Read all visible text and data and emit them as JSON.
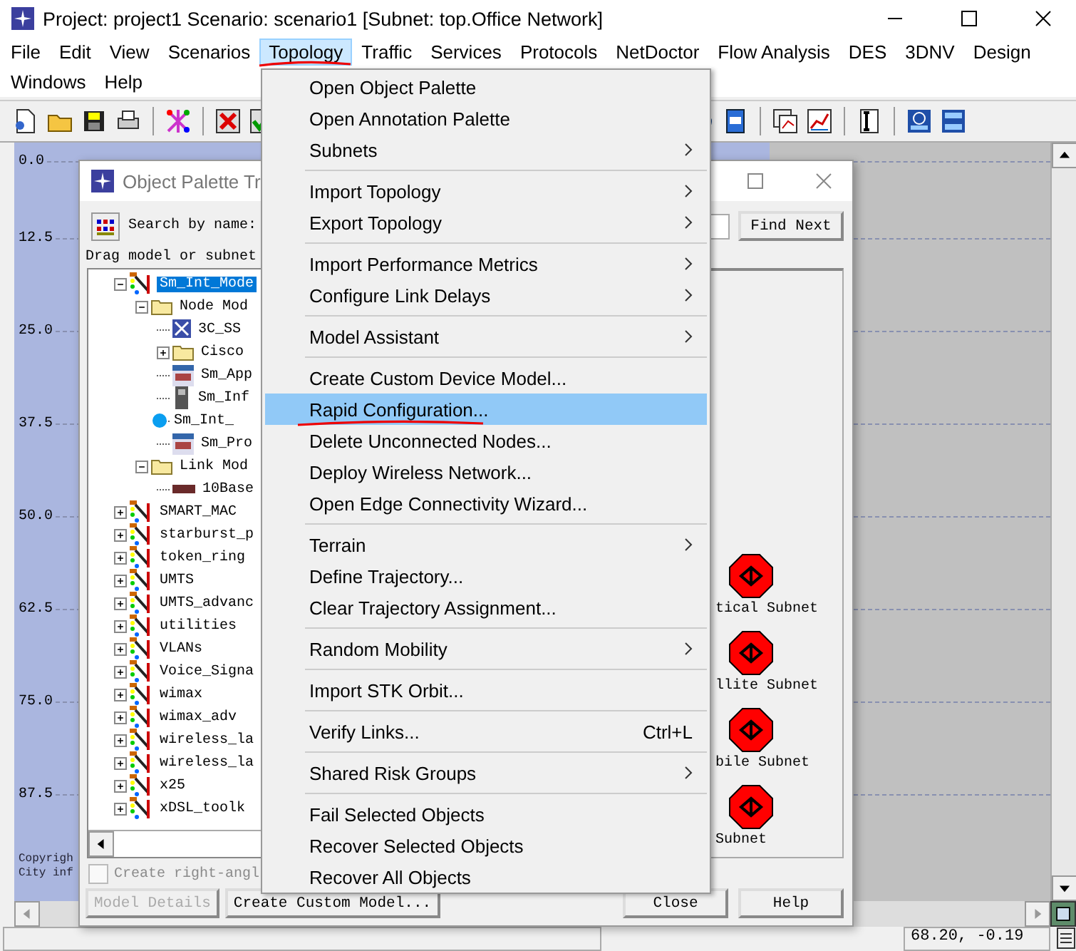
{
  "window": {
    "title": "Project: project1 Scenario: scenario1  [Subnet: top.Office Network]"
  },
  "menu_bar": [
    [
      {
        "label": "File",
        "selected": false,
        "annotated": false
      },
      {
        "label": "Edit",
        "selected": false,
        "annotated": false
      },
      {
        "label": "View",
        "selected": false,
        "annotated": false
      },
      {
        "label": "Scenarios",
        "selected": false,
        "annotated": false
      },
      {
        "label": "Topology",
        "selected": true,
        "annotated": true
      },
      {
        "label": "Traffic",
        "selected": false,
        "annotated": false
      },
      {
        "label": "Services",
        "selected": false,
        "annotated": false
      },
      {
        "label": "Protocols",
        "selected": false,
        "annotated": false
      },
      {
        "label": "NetDoctor",
        "selected": false,
        "annotated": false
      },
      {
        "label": "Flow Analysis",
        "selected": false,
        "annotated": false
      },
      {
        "label": "DES",
        "selected": false,
        "annotated": false
      },
      {
        "label": "3DNV",
        "selected": false,
        "annotated": false
      },
      {
        "label": "Design",
        "selected": false,
        "annotated": false
      }
    ],
    [
      {
        "label": "Windows",
        "selected": false,
        "annotated": false
      },
      {
        "label": "Help",
        "selected": false,
        "annotated": false
      }
    ]
  ],
  "topology_menu": [
    [
      {
        "label": "Open Object Palette",
        "submenu": false,
        "selected": false,
        "annotated": false
      },
      {
        "label": "Open Annotation Palette",
        "submenu": false,
        "selected": false,
        "annotated": false
      },
      {
        "label": "Subnets",
        "submenu": true,
        "selected": false,
        "annotated": false
      }
    ],
    [
      {
        "label": "Import Topology",
        "submenu": true,
        "selected": false,
        "annotated": false
      },
      {
        "label": "Export Topology",
        "submenu": true,
        "selected": false,
        "annotated": false
      }
    ],
    [
      {
        "label": "Import Performance Metrics",
        "submenu": true,
        "selected": false,
        "annotated": false
      },
      {
        "label": "Configure Link Delays",
        "submenu": true,
        "selected": false,
        "annotated": false
      }
    ],
    [
      {
        "label": "Model Assistant",
        "submenu": true,
        "selected": false,
        "annotated": false
      }
    ],
    [
      {
        "label": "Create Custom Device Model...",
        "submenu": false,
        "selected": false,
        "annotated": false
      },
      {
        "label": "Rapid Configuration...",
        "submenu": false,
        "selected": true,
        "annotated": true
      },
      {
        "label": "Delete Unconnected Nodes...",
        "submenu": false,
        "selected": false,
        "annotated": false
      },
      {
        "label": "Deploy Wireless Network...",
        "submenu": false,
        "selected": false,
        "annotated": false
      },
      {
        "label": "Open Edge Connectivity Wizard...",
        "submenu": false,
        "selected": false,
        "annotated": false
      }
    ],
    [
      {
        "label": "Terrain",
        "submenu": true,
        "selected": false,
        "annotated": false
      },
      {
        "label": "Define Trajectory...",
        "submenu": false,
        "selected": false,
        "annotated": false
      },
      {
        "label": "Clear Trajectory Assignment...",
        "submenu": false,
        "selected": false,
        "annotated": false
      }
    ],
    [
      {
        "label": "Random Mobility",
        "submenu": true,
        "selected": false,
        "annotated": false
      }
    ],
    [
      {
        "label": "Import STK Orbit...",
        "submenu": false,
        "selected": false,
        "annotated": false
      }
    ],
    [
      {
        "label": "Verify Links...",
        "submenu": false,
        "selected": false,
        "annotated": false,
        "shortcut": "Ctrl+L"
      }
    ],
    [
      {
        "label": "Shared Risk Groups",
        "submenu": true,
        "selected": false,
        "annotated": false
      }
    ],
    [
      {
        "label": "Fail Selected Objects",
        "submenu": false,
        "selected": false,
        "annotated": false
      },
      {
        "label": "Recover Selected Objects",
        "submenu": false,
        "selected": false,
        "annotated": false
      },
      {
        "label": "Recover All Objects",
        "submenu": false,
        "selected": false,
        "annotated": false
      }
    ]
  ],
  "canvas": {
    "ruler_labels": [
      "0.0",
      "12.5",
      "25.0",
      "37.5",
      "50.0",
      "62.5",
      "75.0",
      "87.5"
    ],
    "copyright": [
      "Copyrigh",
      "City inf"
    ]
  },
  "palette": {
    "title": "Object Palette Tr",
    "search_label": "Search by name:",
    "find_button": "Find Next",
    "hint": "Drag model or subnet",
    "tree": [
      {
        "label": "Sm_Int_Mode",
        "kind": "palette",
        "expanded": true,
        "selected": true,
        "children": [
          {
            "label": "Node Mod",
            "kind": "folder",
            "expanded": true,
            "selected": false,
            "children": [
              {
                "label": "3C_SS",
                "kind": "switch",
                "selected": false
              },
              {
                "label": "Cisco",
                "kind": "folder",
                "expanded": false,
                "selected": false
              },
              {
                "label": "Sm_App",
                "kind": "server",
                "selected": false
              },
              {
                "label": "Sm_Inf",
                "kind": "tower",
                "selected": false
              },
              {
                "label": "Sm_Int_",
                "kind": "dot",
                "selected": false
              },
              {
                "label": "Sm_Pro",
                "kind": "server",
                "selected": false
              }
            ]
          },
          {
            "label": "Link Mod",
            "kind": "folder",
            "expanded": true,
            "selected": false,
            "children": [
              {
                "label": "10Base",
                "kind": "link",
                "selected": false
              }
            ]
          }
        ]
      },
      {
        "label": "SMART_MAC",
        "kind": "palette",
        "expanded": false,
        "selected": false
      },
      {
        "label": "starburst_p",
        "kind": "palette",
        "expanded": false,
        "selected": false
      },
      {
        "label": "token_ring",
        "kind": "palette",
        "expanded": false,
        "selected": false
      },
      {
        "label": "UMTS",
        "kind": "palette",
        "expanded": false,
        "selected": false
      },
      {
        "label": "UMTS_advanc",
        "kind": "palette",
        "expanded": false,
        "selected": false
      },
      {
        "label": "utilities",
        "kind": "palette",
        "expanded": false,
        "selected": false
      },
      {
        "label": "VLANs",
        "kind": "palette",
        "expanded": false,
        "selected": false
      },
      {
        "label": "Voice_Signa",
        "kind": "palette",
        "expanded": false,
        "selected": false
      },
      {
        "label": "wimax",
        "kind": "palette",
        "expanded": false,
        "selected": false
      },
      {
        "label": "wimax_adv",
        "kind": "palette",
        "expanded": false,
        "selected": false
      },
      {
        "label": "wireless_la",
        "kind": "palette",
        "expanded": false,
        "selected": false
      },
      {
        "label": "wireless_la",
        "kind": "palette",
        "expanded": false,
        "selected": false
      },
      {
        "label": "x25",
        "kind": "palette",
        "expanded": false,
        "selected": false
      },
      {
        "label": "xDSL_toolk",
        "kind": "palette",
        "expanded": false,
        "selected": false
      }
    ],
    "subnets": [
      "tical Subnet",
      "llite Subnet",
      "bile Subnet",
      "Subnet"
    ],
    "checkbox": {
      "label": "Create right-angl",
      "checked": false,
      "disabled": true
    },
    "buttons": [
      {
        "label": "Model Details",
        "disabled": true
      },
      {
        "label": "Create Custom Model...",
        "disabled": false
      },
      {
        "label": "Close",
        "disabled": false
      },
      {
        "label": "Help",
        "disabled": false
      }
    ]
  },
  "status_bar": {
    "coordinates": "68.20, -0.19"
  }
}
